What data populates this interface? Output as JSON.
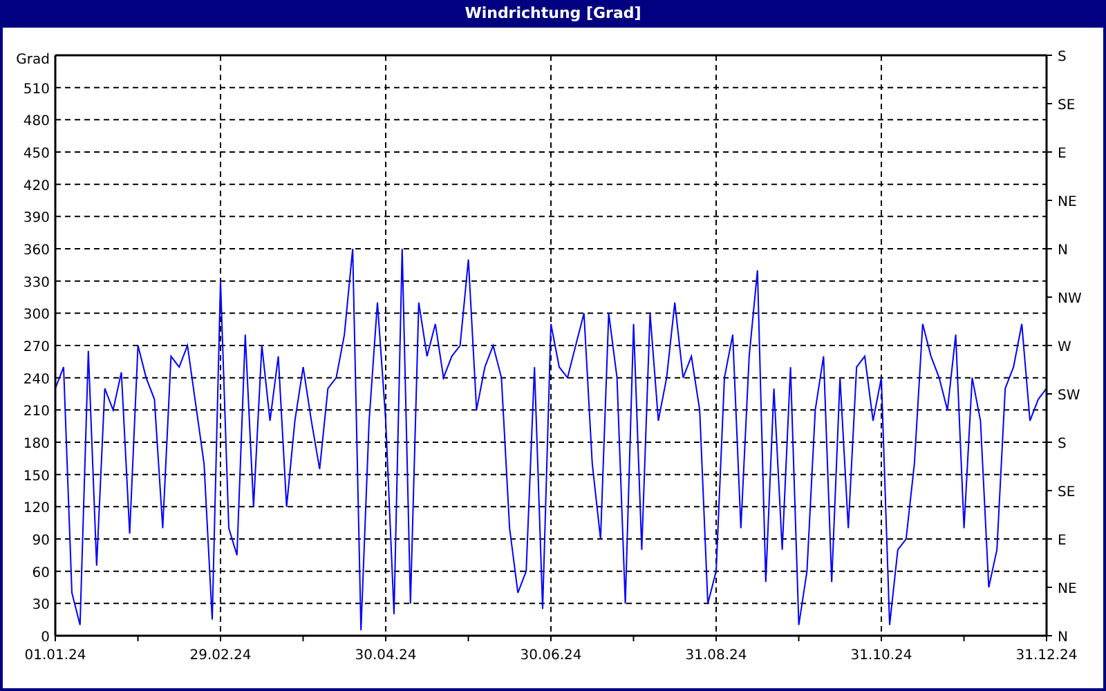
{
  "window": {
    "title": "Windrichtung [Grad]"
  },
  "chart": {
    "right_axis_labels": [
      "S",
      "SE",
      "E",
      "NE",
      "N",
      "NW",
      "W",
      "SW",
      "S",
      "SE",
      "E",
      "NE",
      "N"
    ],
    "chart_data": {
      "type": "line",
      "ylabel": "Grad",
      "ylim": [
        0,
        540
      ],
      "grid": true,
      "categories": [
        "01.01.24",
        null,
        null,
        null,
        null,
        null,
        null,
        null,
        null,
        null,
        null,
        null,
        null,
        null,
        null,
        null,
        null,
        null,
        null,
        null,
        "29.02.24",
        null,
        null,
        null,
        null,
        null,
        null,
        null,
        null,
        null,
        null,
        null,
        null,
        null,
        null,
        null,
        null,
        null,
        null,
        null,
        "30.04.24",
        null,
        null,
        null,
        null,
        null,
        null,
        null,
        null,
        null,
        null,
        null,
        null,
        null,
        null,
        null,
        null,
        null,
        null,
        null,
        "30.06.24",
        null,
        null,
        null,
        null,
        null,
        null,
        null,
        null,
        null,
        null,
        null,
        null,
        null,
        null,
        null,
        null,
        null,
        null,
        null,
        "31.08.24",
        null,
        null,
        null,
        null,
        null,
        null,
        null,
        null,
        null,
        null,
        null,
        null,
        null,
        null,
        null,
        null,
        null,
        null,
        null,
        "31.10.24",
        null,
        null,
        null,
        null,
        null,
        null,
        null,
        null,
        null,
        null,
        null,
        null,
        null,
        null,
        null,
        null,
        null,
        null,
        null,
        "31.12.24"
      ],
      "yticks": [
        0,
        30,
        60,
        90,
        120,
        150,
        180,
        210,
        240,
        270,
        300,
        330,
        360,
        390,
        420,
        450,
        480,
        510
      ],
      "series": [
        {
          "color": "#0000ff",
          "values": [
            230,
            250,
            40,
            10,
            265,
            65,
            230,
            210,
            245,
            95,
            270,
            240,
            220,
            100,
            260,
            250,
            270,
            215,
            160,
            15,
            330,
            100,
            75,
            280,
            120,
            270,
            200,
            260,
            120,
            200,
            250,
            200,
            155,
            230,
            240,
            280,
            360,
            5,
            200,
            310,
            200,
            20,
            360,
            30,
            310,
            260,
            290,
            240,
            260,
            270,
            350,
            210,
            250,
            270,
            240,
            100,
            40,
            60,
            250,
            25,
            290,
            250,
            240,
            270,
            300,
            160,
            90,
            300,
            240,
            30,
            290,
            80,
            300,
            200,
            240,
            310,
            240,
            260,
            210,
            30,
            60,
            240,
            280,
            100,
            260,
            340,
            50,
            230,
            80,
            250,
            10,
            60,
            210,
            260,
            50,
            240,
            100,
            250,
            260,
            200,
            240,
            10,
            80,
            90,
            160,
            290,
            260,
            240,
            210,
            280,
            100,
            240,
            200,
            45,
            80,
            230,
            250,
            290,
            200,
            220,
            230
          ]
        }
      ]
    }
  }
}
